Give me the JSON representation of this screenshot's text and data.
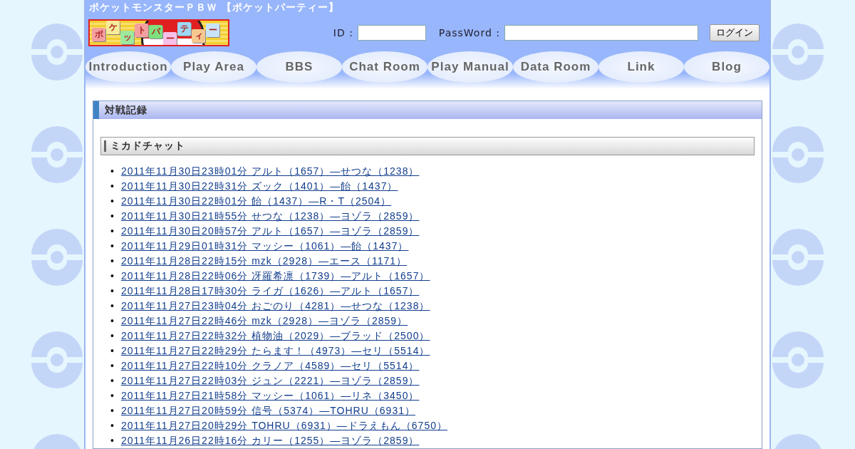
{
  "site_title": "ポケットモンスターＰＢＷ 【ポケットパーティー】",
  "logo_tiles": [
    "ポ",
    "ケ",
    "ッ",
    "ト",
    "パ",
    "ー",
    "テ",
    "ィ",
    "ー"
  ],
  "login": {
    "id_label": "ID :",
    "password_label": "PassWord :",
    "button": "ログイン"
  },
  "nav": [
    {
      "label": "Introduction"
    },
    {
      "label": "Play Area"
    },
    {
      "label": "BBS"
    },
    {
      "label": "Chat Room"
    },
    {
      "label": "Play Manual"
    },
    {
      "label": "Data Room"
    },
    {
      "label": "Link"
    },
    {
      "label": "Blog"
    }
  ],
  "panel": {
    "title": "対戦記録",
    "section_title": "ミカドチャット",
    "bullet": "•",
    "records": [
      "2011年11月30日23時01分 アルト（1657）―せつな（1238）",
      "2011年11月30日22時31分 ズック（1401）―飴（1437）",
      "2011年11月30日22時01分 飴（1437）―R・T（2504）",
      "2011年11月30日21時55分 せつな（1238）―ヨゾラ（2859）",
      "2011年11月30日20時57分 アルト（1657）―ヨゾラ（2859）",
      "2011年11月29日01時31分 マッシー（1061）―飴（1437）",
      "2011年11月28日22時15分 mzk（2928）―エース（1171）",
      "2011年11月28日22時06分 冴羅希凛（1739）―アルト（1657）",
      "2011年11月28日17時30分 ライガ（1626）―アルト（1657）",
      "2011年11月27日23時04分 おごのり（4281）―せつな（1238）",
      "2011年11月27日22時46分 mzk（2928）―ヨゾラ（2859）",
      "2011年11月27日22時32分 植物油（2029）―ブラッド（2500）",
      "2011年11月27日22時29分 たらます！（4973）―セリ（5514）",
      "2011年11月27日22時10分 クラノア（4589）―セリ（5514）",
      "2011年11月27日22時03分 ジュン（2221）―ヨゾラ（2859）",
      "2011年11月27日21時58分 マッシー（1061）―リネ（3450）",
      "2011年11月27日20時59分 信号（5374）―TOHRU（6931）",
      "2011年11月27日20時29分 TOHRU（6931）―ドラえもん（6750）",
      "2011年11月26日22時16分 カリー（1255）―ヨゾラ（2859）"
    ]
  }
}
